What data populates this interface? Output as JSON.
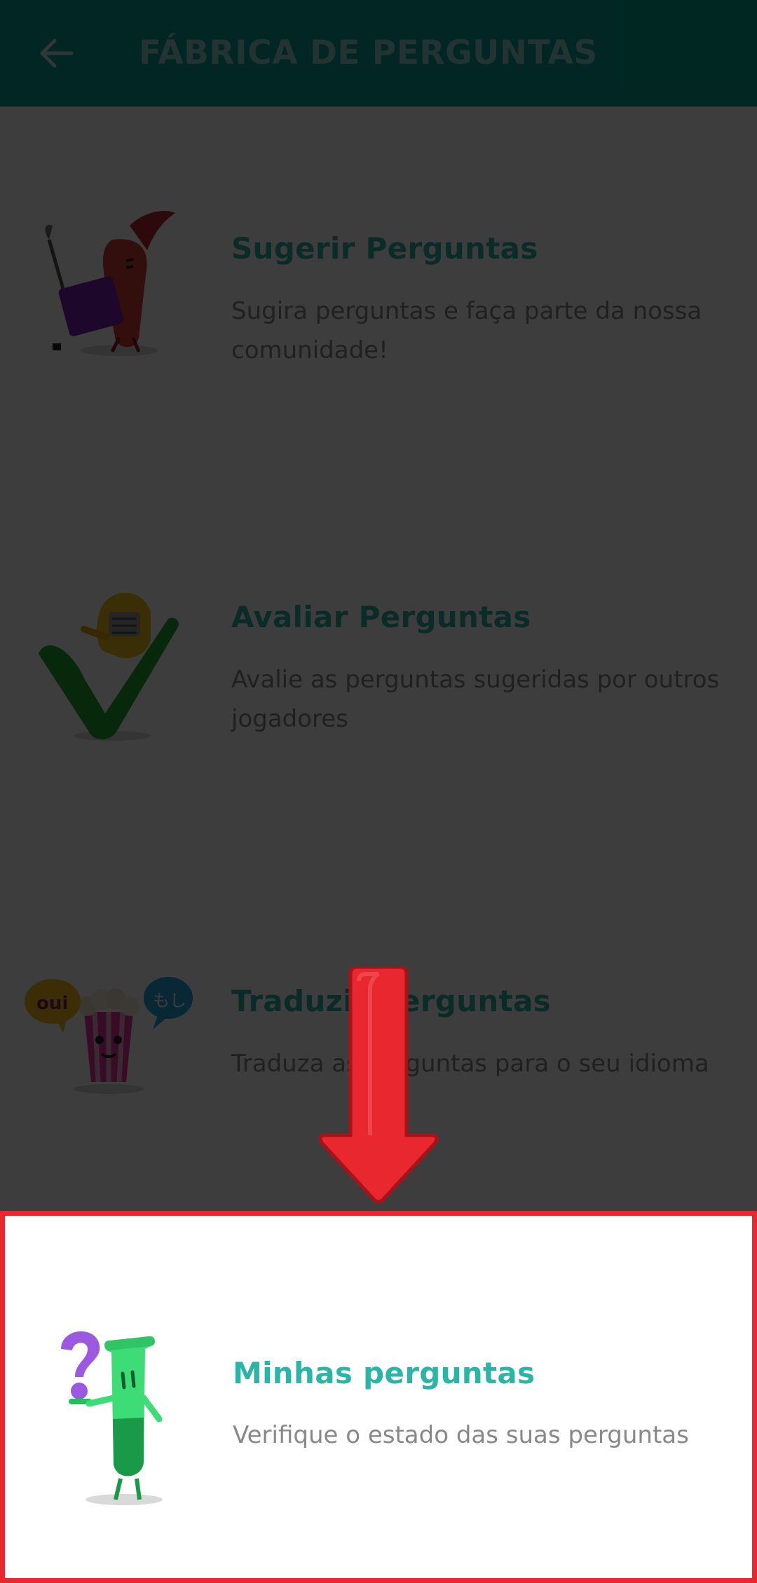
{
  "header": {
    "title": "FÁBRICA DE PERGUNTAS",
    "back_icon": "arrow-left-icon",
    "background": "#06a193"
  },
  "menu": {
    "items": [
      {
        "title": "Sugerir Perguntas",
        "description": "Sugira perguntas e faça parte da nossa comunidade!",
        "icon": "painter-brush-character-icon"
      },
      {
        "title": "Avaliar Perguntas",
        "description": "Avalie as perguntas sugeridas por outros jogadores",
        "icon": "knight-checkmark-character-icon"
      },
      {
        "title": "Traduzir Perguntas",
        "description": "Traduza as perguntas para o seu idioma",
        "icon": "popcorn-translate-character-icon"
      },
      {
        "title": "Minhas perguntas",
        "description": "Verifique o estado das suas perguntas",
        "icon": "test-tube-question-character-icon"
      }
    ]
  },
  "overlay": {
    "highlight_color": "#e8272f",
    "arrow_icon": "arrow-down-icon"
  },
  "colors": {
    "accent": "#2bb5a6",
    "muted_text": "#888888"
  }
}
